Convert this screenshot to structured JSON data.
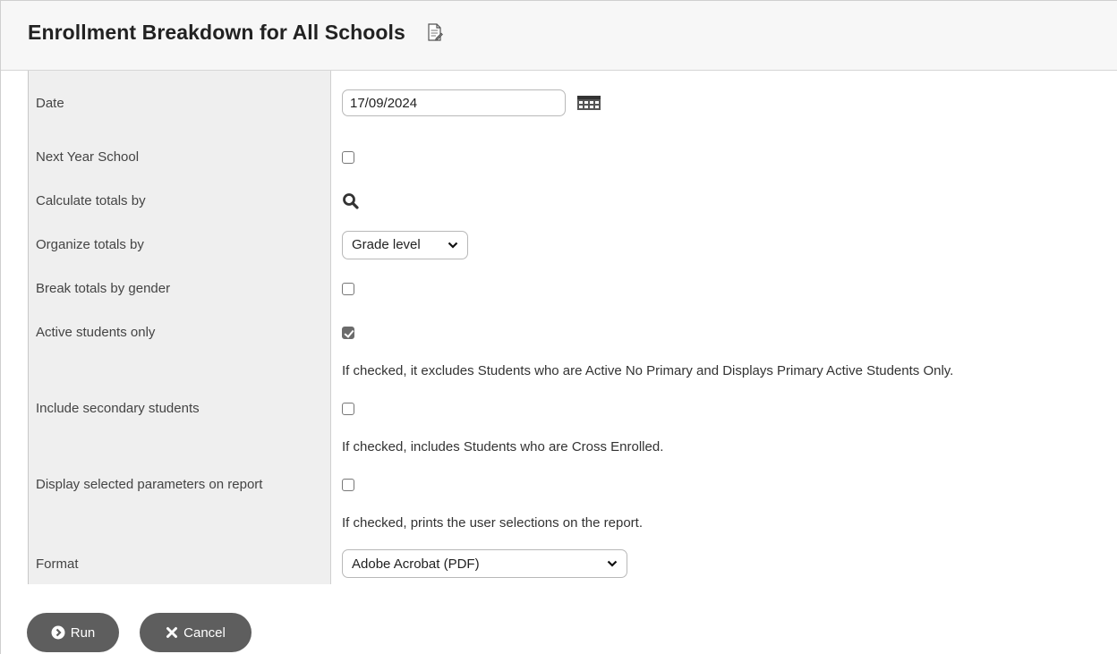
{
  "page": {
    "title": "Enrollment Breakdown for All Schools",
    "title_icon": "document-edit-icon"
  },
  "form": {
    "date": {
      "label": "Date",
      "value": "17/09/2024",
      "icon": "calendar-icon"
    },
    "next_year_school": {
      "label": "Next Year School",
      "checked": false
    },
    "calculate_totals_by": {
      "label": "Calculate totals by",
      "icon": "search-icon"
    },
    "organize_totals_by": {
      "label": "Organize totals by",
      "selected": "Grade level"
    },
    "break_by_gender": {
      "label": "Break totals by gender",
      "checked": false
    },
    "active_only": {
      "label": "Active students only",
      "checked": true,
      "note": "If checked, it excludes Students who are Active No Primary and Displays Primary Active Students Only."
    },
    "include_secondary": {
      "label": "Include secondary students",
      "checked": false,
      "note": "If checked, includes Students who are Cross Enrolled."
    },
    "display_params": {
      "label": "Display selected parameters on report",
      "checked": false,
      "note": "If checked, prints the user selections on the report."
    },
    "format": {
      "label": "Format",
      "selected": "Adobe Acrobat (PDF)"
    }
  },
  "buttons": {
    "run": "Run",
    "cancel": "Cancel"
  }
}
